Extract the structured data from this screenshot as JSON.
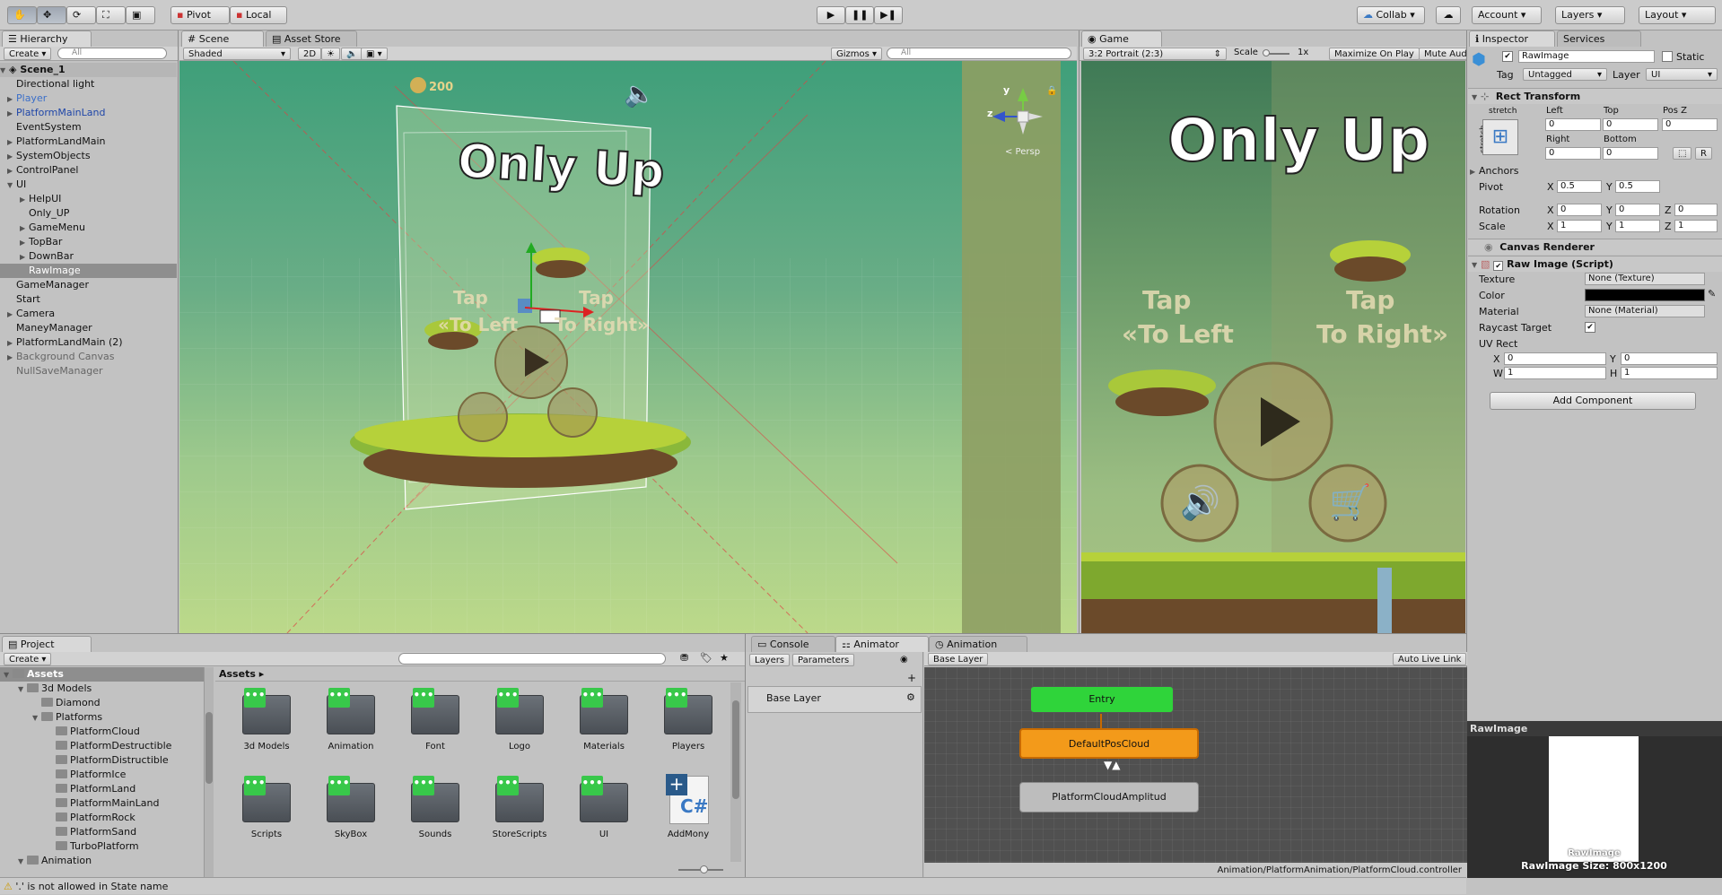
{
  "toolbar": {
    "pivot": "Pivot",
    "local": "Local",
    "collab": "Collab",
    "account": "Account",
    "layers": "Layers",
    "layout": "Layout"
  },
  "hierarchy": {
    "tab": "Hierarchy",
    "create": "Create",
    "search": "All",
    "scene": "Scene_1",
    "items": [
      {
        "label": "Directional light",
        "indent": 1,
        "arrow": "",
        "color": "#111"
      },
      {
        "label": "Player",
        "indent": 1,
        "arrow": "▶",
        "color": "#3b6fc9"
      },
      {
        "label": "PlatformMainLand",
        "indent": 1,
        "arrow": "▶",
        "color": "#1f46a8"
      },
      {
        "label": "EventSystem",
        "indent": 1,
        "arrow": "",
        "color": "#111"
      },
      {
        "label": "PlatformLandMain",
        "indent": 1,
        "arrow": "▶",
        "color": "#111"
      },
      {
        "label": "SystemObjects",
        "indent": 1,
        "arrow": "▶",
        "color": "#111"
      },
      {
        "label": "ControlPanel",
        "indent": 1,
        "arrow": "▶",
        "color": "#111"
      },
      {
        "label": "UI",
        "indent": 1,
        "arrow": "▼",
        "color": "#111"
      },
      {
        "label": "HelpUI",
        "indent": 2,
        "arrow": "▶",
        "color": "#111"
      },
      {
        "label": "Only_UP",
        "indent": 2,
        "arrow": "",
        "color": "#111"
      },
      {
        "label": "GameMenu",
        "indent": 2,
        "arrow": "▶",
        "color": "#111"
      },
      {
        "label": "TopBar",
        "indent": 2,
        "arrow": "▶",
        "color": "#111"
      },
      {
        "label": "DownBar",
        "indent": 2,
        "arrow": "▶",
        "color": "#111"
      },
      {
        "label": "RawImage",
        "indent": 2,
        "arrow": "",
        "color": "#fff",
        "selected": true
      },
      {
        "label": "GameManager",
        "indent": 1,
        "arrow": "",
        "color": "#111"
      },
      {
        "label": "Start",
        "indent": 1,
        "arrow": "",
        "color": "#111"
      },
      {
        "label": "Camera",
        "indent": 1,
        "arrow": "▶",
        "color": "#111"
      },
      {
        "label": "ManeyManager",
        "indent": 1,
        "arrow": "",
        "color": "#111"
      },
      {
        "label": "PlatformLandMain (2)",
        "indent": 1,
        "arrow": "▶",
        "color": "#111"
      },
      {
        "label": "Background Canvas",
        "indent": 1,
        "arrow": "▶",
        "color": "#666"
      },
      {
        "label": "NullSaveManager",
        "indent": 1,
        "arrow": "",
        "color": "#666"
      }
    ]
  },
  "scene": {
    "tab": "Scene",
    "tab2": "Asset Store",
    "shaded": "Shaded",
    "mode2d": "2D",
    "gizmos": "Gizmos",
    "search": "All",
    "persp": "< Persp",
    "axis_y": "y",
    "axis_z": "z",
    "title": "Only Up",
    "tap_left": "Tap",
    "tap_left2": "«To Left",
    "tap_right": "Tap",
    "tap_right2": "To Right»",
    "coins": "200"
  },
  "game": {
    "tab": "Game",
    "aspect": "3:2 Portrait (2:3)",
    "scale_label": "Scale",
    "scale_value": "1x",
    "maximize": "Maximize On Play",
    "mute": "Mute Aud",
    "title": "Only Up",
    "tap_left": "Tap",
    "tap_left2": "«To Left",
    "tap_right": "Tap",
    "tap_right2": "To Right»"
  },
  "inspector": {
    "tab": "Inspector",
    "tab2": "Services",
    "name": "RawImage",
    "static": "Static",
    "tag_label": "Tag",
    "tag": "Untagged",
    "layer_label": "Layer",
    "layer": "UI",
    "rect_title": "Rect Transform",
    "stretch": "stretch",
    "stretch_v": "stretch",
    "left": "Left",
    "top": "Top",
    "posz": "Pos Z",
    "left_v": "0",
    "top_v": "0",
    "posz_v": "0",
    "right": "Right",
    "bottom": "Bottom",
    "right_v": "0",
    "bottom_v": "0",
    "anchors": "Anchors",
    "pivot": "Pivot",
    "pivot_x": "0.5",
    "pivot_y": "0.5",
    "rotation": "Rotation",
    "rot_x": "0",
    "rot_y": "0",
    "rot_z": "0",
    "scale": "Scale",
    "sc_x": "1",
    "sc_y": "1",
    "sc_z": "1",
    "canvas_renderer": "Canvas Renderer",
    "raw_image": "Raw Image (Script)",
    "texture": "Texture",
    "texture_v": "None (Texture)",
    "color": "Color",
    "material": "Material",
    "material_v": "None (Material)",
    "raycast": "Raycast Target",
    "uvrect": "UV Rect",
    "uv_x": "0",
    "uv_y": "0",
    "uv_w": "1",
    "uv_h": "1",
    "add_component": "Add Component",
    "x": "X",
    "y": "Y",
    "z": "Z",
    "w": "W",
    "h": "H",
    "r": "R",
    "preview_title": "RawImage",
    "preview_name": "RawImage",
    "preview_size": "RawImage Size: 800x1200"
  },
  "project": {
    "tab": "Project",
    "create": "Create",
    "root": "Assets",
    "breadcrumb": "Assets ▸",
    "tree": [
      {
        "label": "Assets",
        "indent": 0,
        "arrow": "▼",
        "bold": true
      },
      {
        "label": "3d Models",
        "indent": 1,
        "arrow": "▼"
      },
      {
        "label": "Diamond",
        "indent": 2,
        "arrow": ""
      },
      {
        "label": "Platforms",
        "indent": 2,
        "arrow": "▼"
      },
      {
        "label": "PlatformCloud",
        "indent": 3,
        "arrow": ""
      },
      {
        "label": "PlatformDestructible",
        "indent": 3,
        "arrow": ""
      },
      {
        "label": "PlatformDistructible",
        "indent": 3,
        "arrow": ""
      },
      {
        "label": "PlatformIce",
        "indent": 3,
        "arrow": ""
      },
      {
        "label": "PlatformLand",
        "indent": 3,
        "arrow": ""
      },
      {
        "label": "PlatformMainLand",
        "indent": 3,
        "arrow": ""
      },
      {
        "label": "PlatformRock",
        "indent": 3,
        "arrow": ""
      },
      {
        "label": "PlatformSand",
        "indent": 3,
        "arrow": ""
      },
      {
        "label": "TurboPlatform",
        "indent": 3,
        "arrow": ""
      },
      {
        "label": "Animation",
        "indent": 1,
        "arrow": "▼"
      }
    ],
    "folders": [
      "3d Models",
      "Animation",
      "Font",
      "Logo",
      "Materials",
      "Players",
      "Scripts",
      "SkyBox",
      "Sounds",
      "StoreScripts",
      "UI",
      "AddMony"
    ]
  },
  "console": {
    "tab": "Console"
  },
  "animator": {
    "tab": "Animator",
    "tab2": "Animation",
    "layers": "Layers",
    "parameters": "Parameters",
    "base_layer": "Base Layer",
    "breadcrumb": "Base Layer",
    "auto_live": "Auto Live Link",
    "entry": "Entry",
    "default": "DefaultPosCloud",
    "amplitud": "PlatformCloudAmplitud",
    "path": "Animation/PlatformAnimation/PlatformCloud.controller"
  },
  "status": {
    "message": "'.' is not allowed in State name"
  }
}
